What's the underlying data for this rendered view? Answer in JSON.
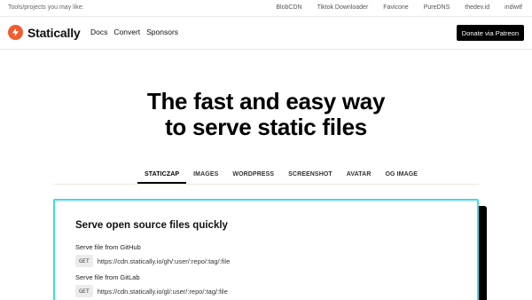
{
  "topbar": {
    "label": "Tools/projects you may like:",
    "links": [
      "BlobCDN",
      "Tiktok Downloader",
      "Favicone",
      "PureDNS",
      "thedev.id",
      "indiwtf"
    ]
  },
  "header": {
    "brand": "Statically",
    "brand_icon": "lightning-bolt-icon",
    "brand_color": "#f25c2e",
    "nav": [
      "Docs",
      "Convert",
      "Sponsors"
    ],
    "donate_label": "Donate via Patreon"
  },
  "hero": {
    "line1": "The fast and easy way",
    "line2": "to serve static files"
  },
  "tabs": {
    "items": [
      "STATICZAP",
      "IMAGES",
      "WORDPRESS",
      "SCREENSHOT",
      "AVATAR",
      "OG IMAGE"
    ],
    "active": "STATICZAP"
  },
  "card": {
    "accent": "#3ddbea",
    "title": "Serve open source files quickly",
    "rows": [
      {
        "label": "Serve file from GitHub",
        "method": "GET",
        "url": "https://cdn.statically.io/gh/:user/:repo/:tag/:file"
      },
      {
        "label": "Serve file from GitLab",
        "method": "GET",
        "url": "https://cdn.statically.io/gl/:user/:repo/:tag/:file"
      }
    ]
  }
}
